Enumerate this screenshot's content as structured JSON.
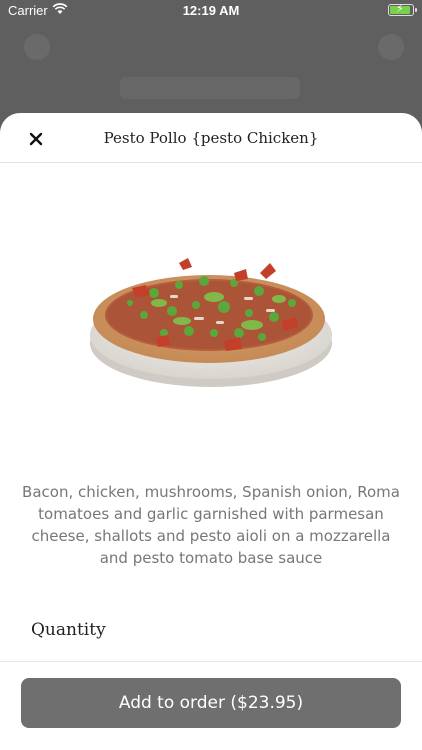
{
  "status_bar": {
    "carrier": "Carrier",
    "time": "12:19 AM"
  },
  "sheet": {
    "title": "Pesto Pollo {pesto Chicken}",
    "description": "Bacon, chicken, mushrooms, Spanish onion, Roma tomatoes and garlic garnished with parmesan cheese, shallots and pesto aioli on a mozzarella and pesto tomato base sauce",
    "quantity_label": "Quantity",
    "add_button_label": "Add to order ($23.95)"
  },
  "icons": {
    "close": "close-icon",
    "wifi": "wifi-icon",
    "battery": "battery-icon"
  }
}
